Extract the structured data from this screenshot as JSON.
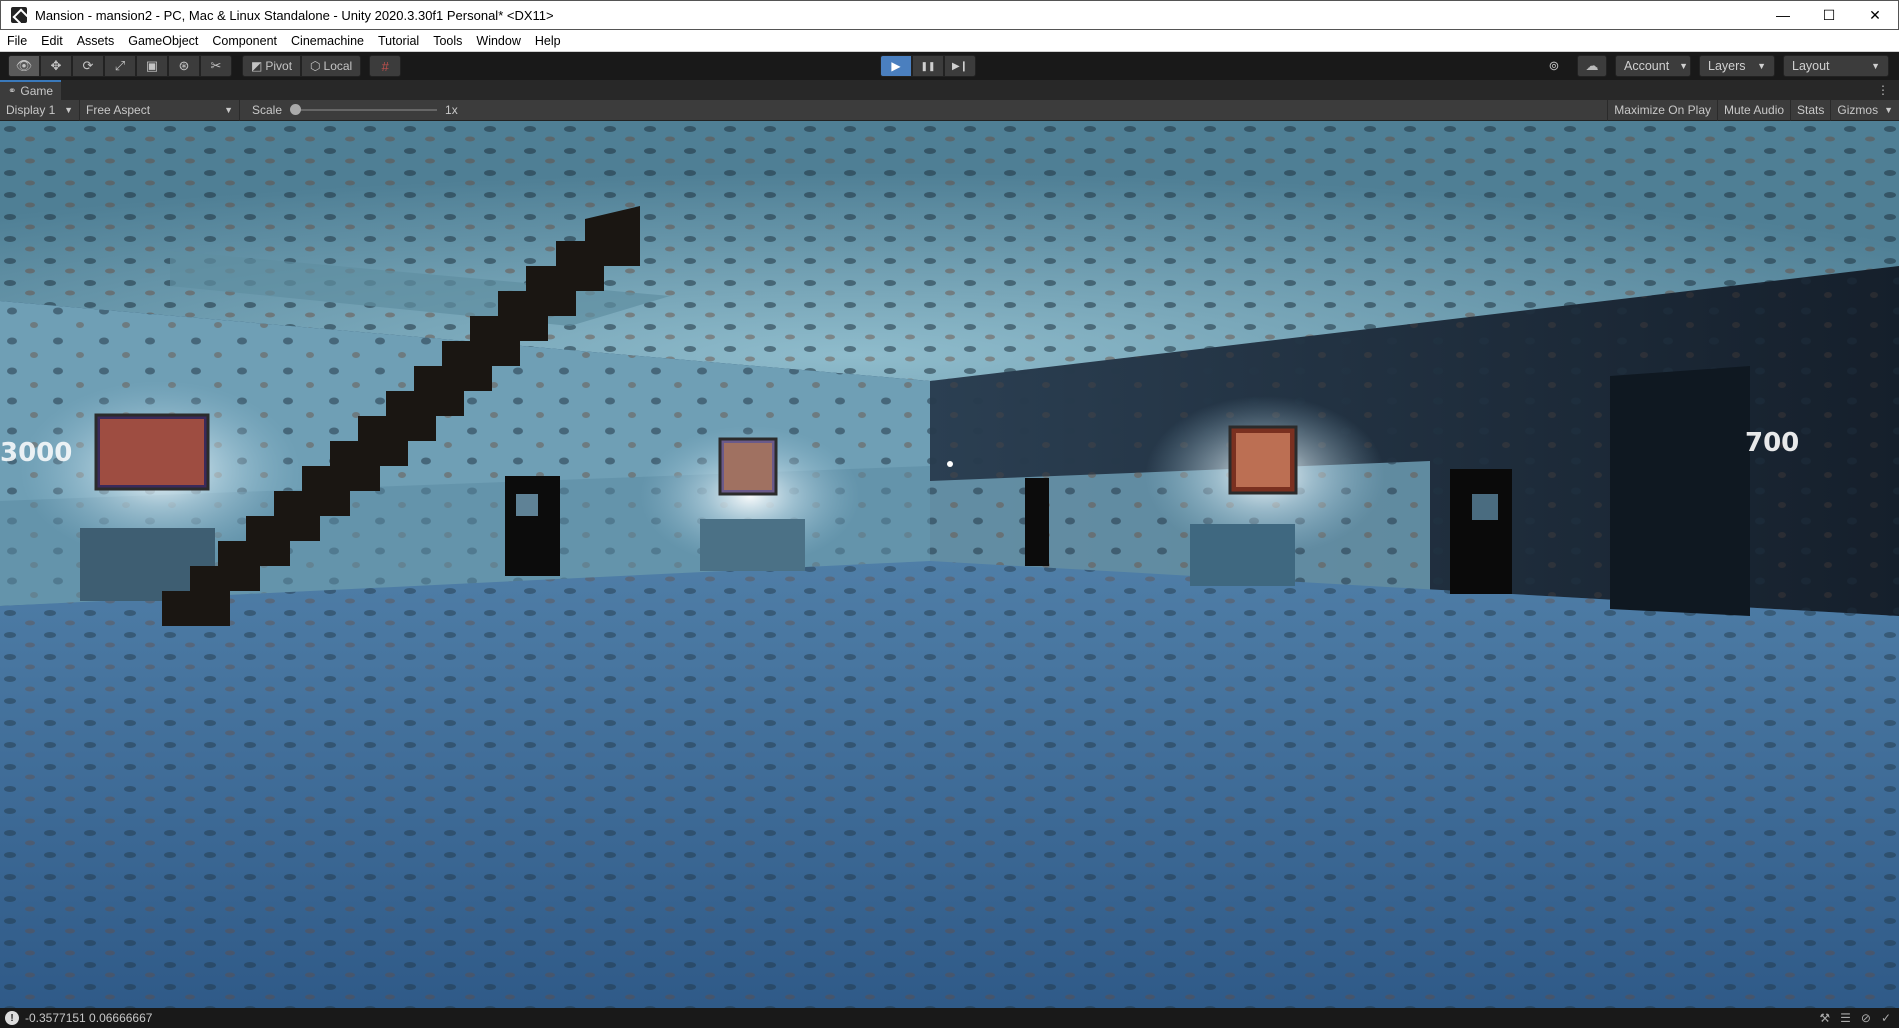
{
  "window": {
    "title": "Mansion - mansion2 - PC, Mac & Linux Standalone - Unity 2020.3.30f1 Personal* <DX11>",
    "minimize_glyph": "—",
    "maximize_glyph": "☐",
    "close_glyph": "✕"
  },
  "menu": {
    "items": [
      "File",
      "Edit",
      "Assets",
      "GameObject",
      "Component",
      "Cinemachine",
      "Tutorial",
      "Tools",
      "Window",
      "Help"
    ]
  },
  "toolbar": {
    "tools": [
      {
        "name": "view-tool-icon",
        "glyph": "👁"
      },
      {
        "name": "move-tool-icon",
        "glyph": "✥"
      },
      {
        "name": "rotate-tool-icon",
        "glyph": "⟳"
      },
      {
        "name": "scale-tool-icon",
        "glyph": "⤢"
      },
      {
        "name": "rect-tool-icon",
        "glyph": "▣"
      },
      {
        "name": "transform-tool-icon",
        "glyph": "⊛"
      },
      {
        "name": "custom-tool-icon",
        "glyph": "✂"
      }
    ],
    "pivot_label": "Pivot",
    "local_label": "Local",
    "snap_glyph": "#",
    "play_glyph": "▶",
    "pause_glyph": "❚❚",
    "step_glyph": "▶❙",
    "collab_glyph": "⊚",
    "cloud_glyph": "☁",
    "account_label": "Account",
    "layers_label": "Layers",
    "layout_label": "Layout"
  },
  "game_tab": {
    "label": "Game",
    "icon_glyph": "⚭",
    "menu_glyph": "⋮"
  },
  "game_bar": {
    "display": "Display 1",
    "aspect": "Free Aspect",
    "scale_label": "Scale",
    "scale_value": "1x",
    "maximize_on_play": "Maximize On Play",
    "mute_audio": "Mute Audio",
    "stats": "Stats",
    "gizmos": "Gizmos"
  },
  "scene": {
    "left_sign": "3000",
    "right_sign": "700"
  },
  "status": {
    "message": "-0.3577151 0.06666667",
    "info_glyph": "!",
    "right_icons": [
      "⚒",
      "☰",
      "⊘",
      "✓"
    ]
  },
  "colors": {
    "accent_blue": "#4a7fbf",
    "ceiling": "#5d8fa6",
    "floor": "#3f6d9a",
    "dark_wall": "#1c2a3b"
  }
}
